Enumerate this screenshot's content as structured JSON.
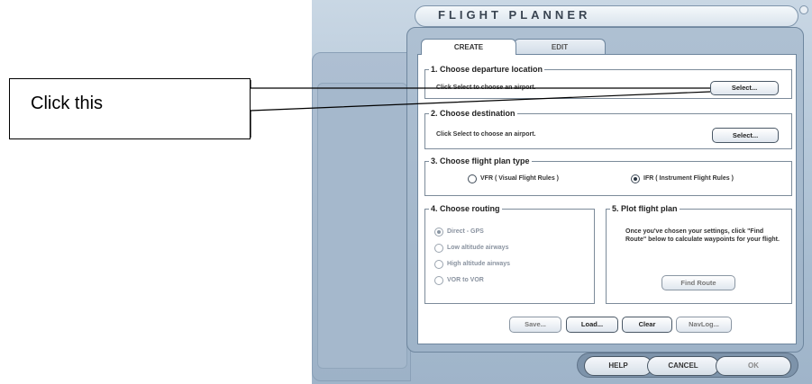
{
  "callout": {
    "text": "Click this"
  },
  "window": {
    "title": "FLIGHT PLANNER"
  },
  "tabs": [
    {
      "label": "CREATE"
    },
    {
      "label": "EDIT"
    }
  ],
  "sections": {
    "departure": {
      "legend": "1. Choose departure location",
      "hint": "Click Select to choose an airport.",
      "button": "Select..."
    },
    "destination": {
      "legend": "2. Choose destination",
      "hint": "Click Select to choose an airport.",
      "button": "Select..."
    },
    "flight_type": {
      "legend": "3. Choose flight plan type",
      "options": [
        {
          "label": "VFR  ( Visual Flight Rules )",
          "selected": false
        },
        {
          "label": "IFR  ( Instrument Flight Rules )",
          "selected": true
        }
      ]
    },
    "routing": {
      "legend": "4. Choose routing",
      "options": [
        {
          "label": "Direct - GPS",
          "selected": true
        },
        {
          "label": "Low altitude airways",
          "selected": false
        },
        {
          "label": "High altitude airways",
          "selected": false
        },
        {
          "label": "VOR to VOR",
          "selected": false
        }
      ]
    },
    "plot": {
      "legend": "5. Plot flight plan",
      "text": "Once you've chosen your settings, click \"Find Route\" below to calculate waypoints for your flight.",
      "button": "Find Route"
    }
  },
  "actions": {
    "save": "Save...",
    "load": "Load...",
    "clear": "Clear",
    "navlog": "NavLog..."
  },
  "footer": {
    "help": "HELP",
    "cancel": "CANCEL",
    "ok": "OK"
  }
}
